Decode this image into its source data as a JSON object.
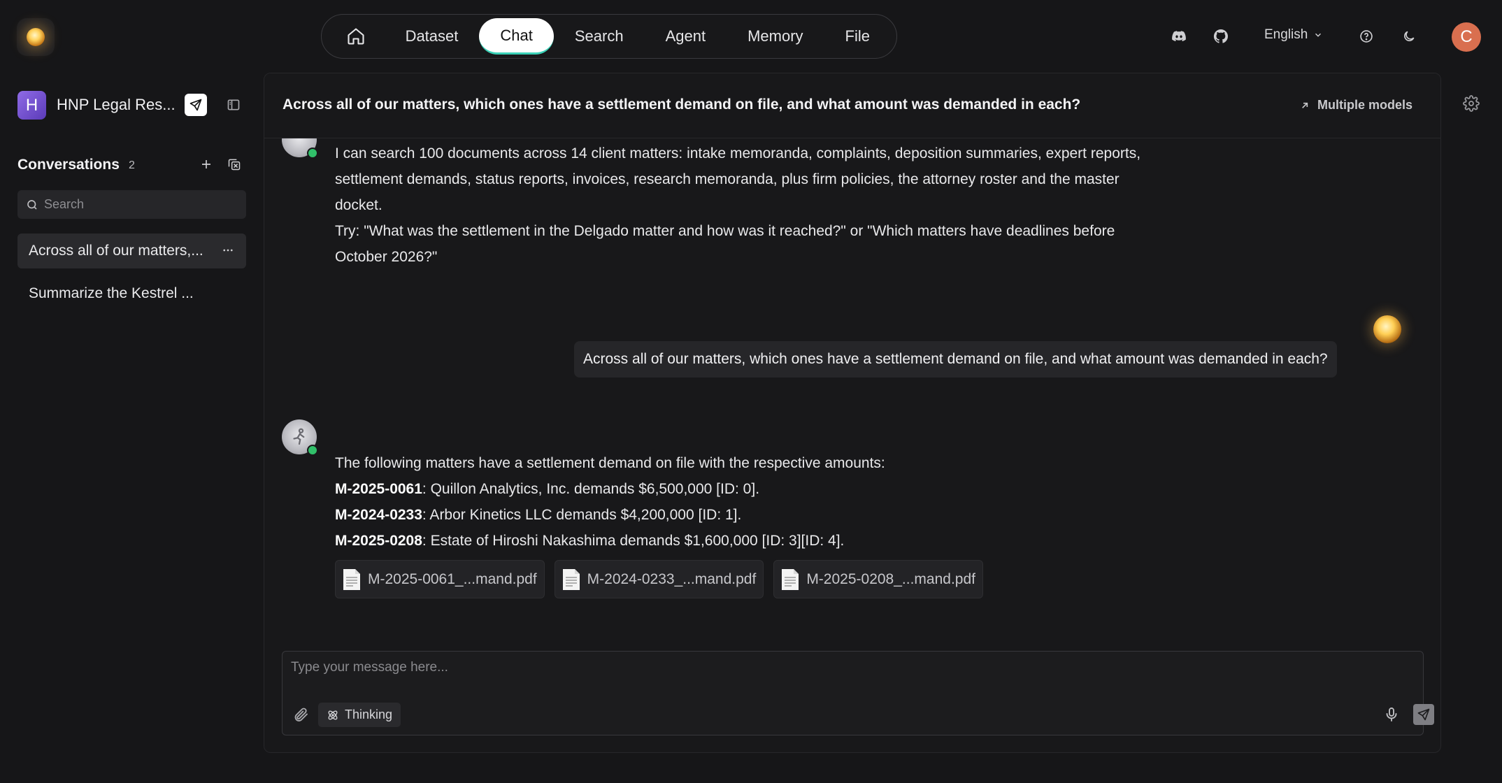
{
  "nav": {
    "home_icon": "home-icon",
    "items": [
      "Dataset",
      "Chat",
      "Search",
      "Agent",
      "Memory",
      "File"
    ],
    "active": "Chat"
  },
  "topbar": {
    "language": "English",
    "user_initial": "C",
    "icons": [
      "discord-icon",
      "github-icon",
      "help-icon",
      "moon-icon"
    ]
  },
  "sidebar": {
    "kb_initial": "H",
    "kb_name": "HNP Legal Res...",
    "conversations_label": "Conversations",
    "conversations_count": "2",
    "search_placeholder": "Search",
    "items": [
      {
        "label": "Across all of our matters,..."
      },
      {
        "label": "Summarize the Kestrel ..."
      }
    ]
  },
  "main": {
    "title": "Across all of our matters, which ones have a settlement demand on file, and what amount was demanded in each?",
    "multiple_models": "Multiple models",
    "intro": {
      "line1": "I can search 100 documents across 14 client matters: intake memoranda, complaints, deposition summaries, expert reports,",
      "line2": "settlement demands, status reports, invoices, research memoranda, plus firm policies, the attorney roster and the master",
      "line3": "docket.",
      "line4": "Try: \"What was the settlement in the Delgado matter and how was it reached?\" or \"Which matters have deadlines before",
      "line5": "October 2026?\""
    },
    "user_message": "Across all of our matters, which ones have a settlement demand on file, and what amount was demanded in each?",
    "answer": {
      "intro": "The following matters have a settlement demand on file with the respective amounts:",
      "rows": [
        {
          "id": "M-2025-0061",
          "text": ": Quillon Analytics, Inc. demands $6,500,000 [ID: 0]."
        },
        {
          "id": "M-2024-0233",
          "text": ": Arbor Kinetics LLC demands $4,200,000 [ID: 1]."
        },
        {
          "id": "M-2025-0208",
          "text": ": Estate of Hiroshi Nakashima demands $1,600,000 [ID: 3][ID: 4]."
        }
      ],
      "documents": [
        "M-2025-0061_...mand.pdf",
        "M-2024-0233_...mand.pdf",
        "M-2025-0208_...mand.pdf"
      ]
    },
    "composer": {
      "placeholder": "Type your message here...",
      "thinking_label": "Thinking"
    }
  }
}
